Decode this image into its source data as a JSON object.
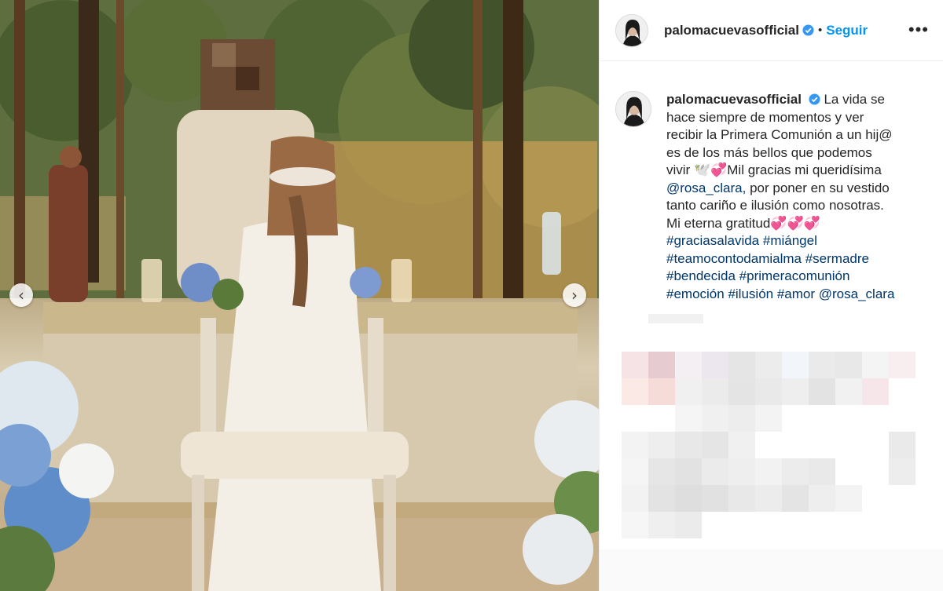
{
  "post": {
    "username": "palomacuevasofficial",
    "separator": "•",
    "follow_label": "Seguir",
    "more_label": "•••",
    "nav_prev": "‹",
    "nav_next": "›"
  },
  "caption": {
    "username": "palomacuevasofficial",
    "lines": [
      "La vida se",
      "hace siempre de momentos y ver",
      "recibir la Primera Comunión a un hij@",
      "es de los más bellos que podemos",
      "vivir 🕊️💞Mil gracias mi queridísima",
      "por poner en su vestido",
      "tanto cariño e ilusión como nosotras.",
      "Mi eterna gratitud💞💞💞"
    ],
    "mention1": "@rosa_clara,",
    "hashtags": [
      "#graciasalavida",
      "#miángel",
      "#teamocontodamialma",
      "#sermadre",
      "#bendecida",
      "#primeracomunión",
      "#emoción",
      "#ilusión",
      "#amor",
      "@rosa_clara"
    ]
  },
  "colors": {
    "follow": "#0095f6",
    "hashtag": "#00376b",
    "verified": "#3897f0"
  },
  "icons": [
    "verified-badge-icon",
    "chevron-left-icon",
    "chevron-right-icon",
    "more-options-icon"
  ]
}
